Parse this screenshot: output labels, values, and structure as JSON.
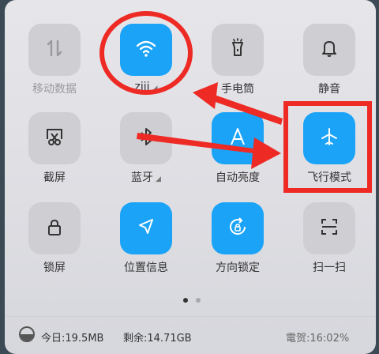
{
  "tiles": [
    {
      "label": "移动数据",
      "icon": "mobile-data-icon",
      "active": false
    },
    {
      "label": "ziji",
      "icon": "wifi-icon",
      "active": true
    },
    {
      "label": "手电筒",
      "icon": "flashlight-icon",
      "active": false
    },
    {
      "label": "静音",
      "icon": "bell-icon",
      "active": false
    },
    {
      "label": "截屏",
      "icon": "screenshot-icon",
      "active": false
    },
    {
      "label": "蓝牙",
      "icon": "bluetooth-icon",
      "active": false
    },
    {
      "label": "自动亮度",
      "icon": "auto-brightness-icon",
      "active": true
    },
    {
      "label": "飞行模式",
      "icon": "airplane-icon",
      "active": true
    },
    {
      "label": "锁屏",
      "icon": "lock-icon",
      "active": false
    },
    {
      "label": "位置信息",
      "icon": "location-icon",
      "active": true
    },
    {
      "label": "方向锁定",
      "icon": "rotation-lock-icon",
      "active": true
    },
    {
      "label": "扫一扫",
      "icon": "scan-icon",
      "active": false
    }
  ],
  "footer": {
    "today": "今日:19.5MB",
    "remaining": "剩余:14.71GB",
    "battery": "電贺:16:02%"
  },
  "colors": {
    "accent": "#1aa3f7",
    "annotation": "#ee2a24",
    "tile_off": "#cfcfd3"
  }
}
